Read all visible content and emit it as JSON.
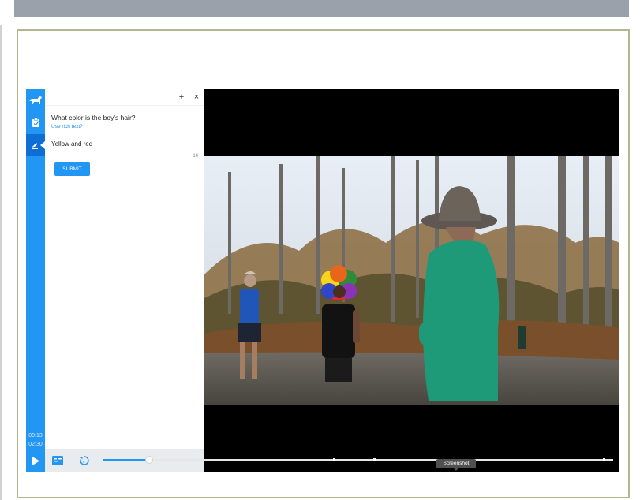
{
  "annotation_panel": {
    "add_label": "+",
    "close_label": "×",
    "question": "What color is the boy's hair?",
    "rich_text_link": "Use rich text?",
    "answer_value": "Yellow and red",
    "char_count": "14",
    "submit_label": "SUBMIT"
  },
  "rail": {
    "current_time": "00:13",
    "total_time": "02:30",
    "icons": [
      "dog-logo-icon",
      "clipboard-check-icon",
      "pen-icon"
    ]
  },
  "player": {
    "tooltip": "Screenshot",
    "progress_fraction": 0.09,
    "marker_fractions": [
      0.45,
      0.53,
      0.98
    ]
  },
  "colors": {
    "accent": "#2196f3",
    "accent_dark": "#0d6fd6",
    "frame_border": "#b1b790",
    "topbar": "#9aa1ab"
  }
}
